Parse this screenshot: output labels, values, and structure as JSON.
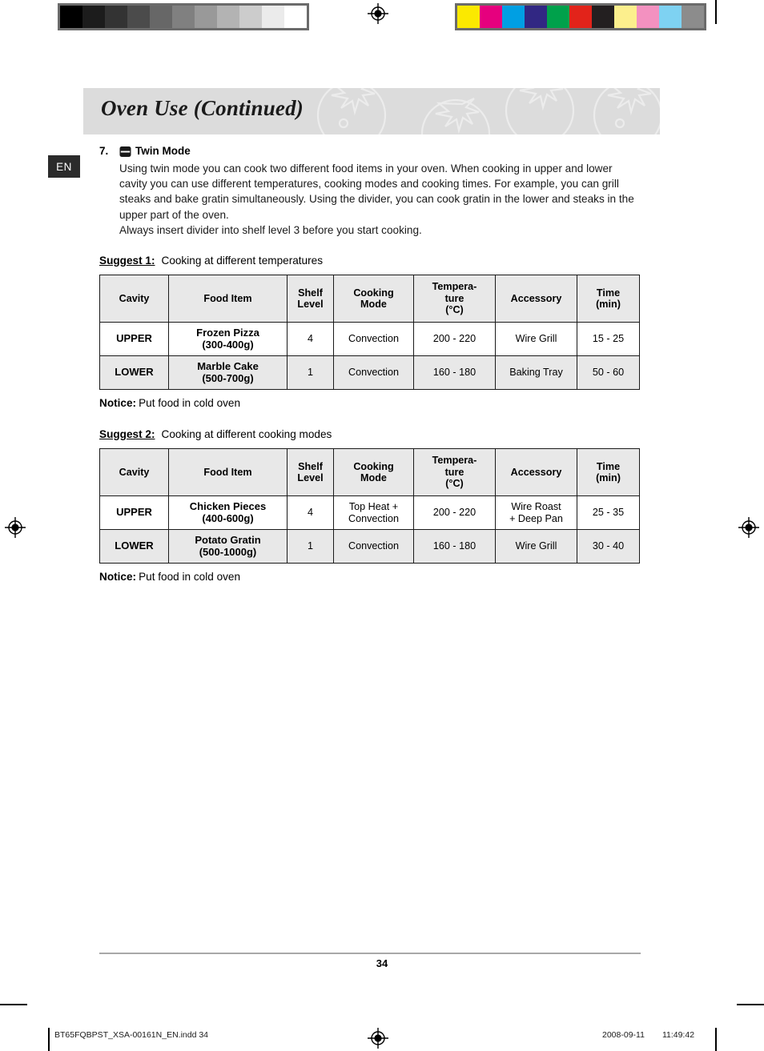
{
  "prepress": {
    "grey_swatches": [
      "#000000",
      "#1c1c1c",
      "#333333",
      "#4b4b4b",
      "#676767",
      "#808080",
      "#999999",
      "#b3b3b3",
      "#cccccc",
      "#ebebeb",
      "#ffffff"
    ],
    "color_swatches": [
      "#fbe900",
      "#e6007e",
      "#009fe3",
      "#312783",
      "#00a14b",
      "#e2231a",
      "#231f20",
      "#fcef8d",
      "#f391c0",
      "#7ed2f2",
      "#8c8c8c"
    ],
    "registration_mark": "registration-target-icon",
    "crop_mark": "crop-mark"
  },
  "header": {
    "title": "Oven Use (Continued)",
    "lang_tab": "EN",
    "watermark": "tomato-outline-watermark"
  },
  "section": {
    "number": "7.",
    "icon": "twin-mode-icon",
    "title": "Twin Mode",
    "paragraphs": [
      "Using twin mode you can cook two different food items in your oven. When cooking in upper and lower cavity you can use different temperatures, cooking modes and cooking times. For example, you can grill steaks and bake gratin simultaneously. Using the divider, you can cook gratin in the lower and steaks in the upper part of the oven.",
      "Always insert divider into shelf level 3 before you start cooking."
    ]
  },
  "suggest1": {
    "label": "Suggest 1:",
    "caption": "Cooking at different temperatures",
    "notice_label": "Notice:",
    "notice_text": "Put food in cold oven",
    "columns": [
      "Cavity",
      "Food Item",
      "Shelf\nLevel",
      "Cooking\nMode",
      "Tempera-\nture\n(°C)",
      "Accessory",
      "Time\n(min)"
    ],
    "columns_display": {
      "cavity": "Cavity",
      "food": "Food Item",
      "shelf_1": "Shelf",
      "shelf_2": "Level",
      "mode_1": "Cooking",
      "mode_2": "Mode",
      "temp_1": "Tempera-",
      "temp_2": "ture",
      "temp_3": "(°C)",
      "accessory": "Accessory",
      "time_1": "Time",
      "time_2": "(min)"
    },
    "rows": [
      {
        "cavity": "UPPER",
        "food_name": "Frozen Pizza",
        "food_weight": "(300-400g)",
        "shelf_level": "4",
        "cooking_mode": "Convection",
        "temperature": "200 - 220",
        "accessory": "Wire Grill",
        "time": "15 - 25"
      },
      {
        "cavity": "LOWER",
        "food_name": "Marble Cake",
        "food_weight": "(500-700g)",
        "shelf_level": "1",
        "cooking_mode": "Convection",
        "temperature": "160 - 180",
        "accessory": "Baking Tray",
        "time": "50 - 60"
      }
    ]
  },
  "suggest2": {
    "label": "Suggest 2:",
    "caption": "Cooking at different cooking modes",
    "notice_label": "Notice:",
    "notice_text": "Put food in cold oven",
    "columns_display": {
      "cavity": "Cavity",
      "food": "Food Item",
      "shelf_1": "Shelf",
      "shelf_2": "Level",
      "mode_1": "Cooking",
      "mode_2": "Mode",
      "temp_1": "Tempera-",
      "temp_2": "ture",
      "temp_3": "(°C)",
      "accessory": "Accessory",
      "time_1": "Time",
      "time_2": "(min)"
    },
    "rows": [
      {
        "cavity": "UPPER",
        "food_name": "Chicken Pieces",
        "food_weight": "(400-600g)",
        "shelf_level": "4",
        "cooking_mode_1": "Top Heat +",
        "cooking_mode_2": "Convection",
        "temperature": "200 - 220",
        "accessory_1": "Wire Roast",
        "accessory_2": "+ Deep Pan",
        "time": "25 - 35"
      },
      {
        "cavity": "LOWER",
        "food_name": "Potato Gratin",
        "food_weight": "(500-1000g)",
        "shelf_level": "1",
        "cooking_mode_1": "Convection",
        "cooking_mode_2": "",
        "temperature": "160 - 180",
        "accessory_1": "Wire Grill",
        "accessory_2": "",
        "time": "30 - 40"
      }
    ]
  },
  "footer": {
    "page_number": "34",
    "imprint_file": "BT65FQBPST_XSA-00161N_EN.indd   34",
    "imprint_date": "2008-09-11",
    "imprint_time": "11:49:42"
  }
}
